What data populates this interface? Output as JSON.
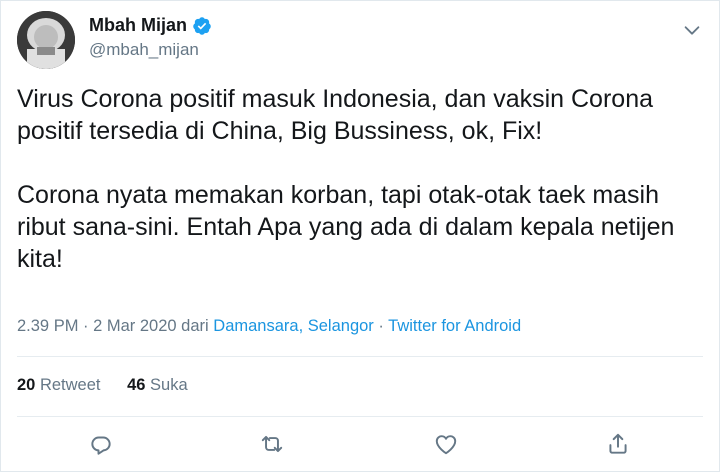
{
  "user": {
    "display_name": "Mbah Mijan",
    "handle": "@mbah_mijan",
    "verified": true
  },
  "tweet": {
    "paragraph1": "Virus Corona positif masuk Indonesia, dan vaksin Corona positif tersedia di China, Big Bussiness, ok, Fix!",
    "paragraph2": "Corona nyata memakan korban, tapi otak-otak taek masih ribut sana-sini.  Entah Apa yang ada di dalam kepala netijen kita!"
  },
  "meta": {
    "time": "2.39 PM",
    "sep1": " · ",
    "date": "2 Mar 2020",
    "dari": " dari ",
    "location": "Damansara, Selangor",
    "sep2": " · ",
    "source": "Twitter for Android"
  },
  "stats": {
    "retweets_count": "20",
    "retweets_label": "Retweet",
    "likes_count": "46",
    "likes_label": "Suka"
  },
  "colors": {
    "accent": "#1b95e0",
    "verified": "#1da1f2",
    "secondary_text": "#657786",
    "icon": "#657786"
  },
  "icons": {
    "more": "chevron-down-icon",
    "reply": "reply-icon",
    "retweet": "retweet-icon",
    "like": "heart-icon",
    "share": "share-icon"
  }
}
